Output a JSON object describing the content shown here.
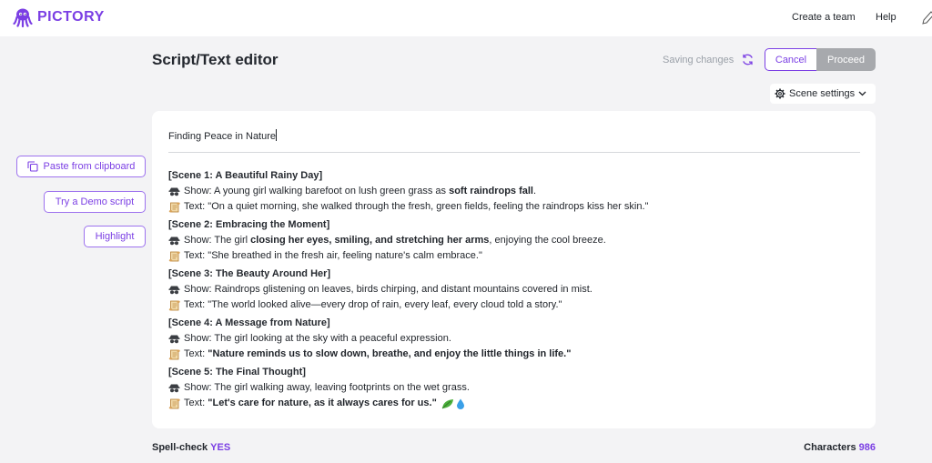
{
  "app": {
    "brand": "PICTORY",
    "brand_color": "#7b3fe4"
  },
  "topnav": {
    "create_team": "Create a team",
    "help": "Help"
  },
  "header": {
    "title": "Script/Text editor",
    "saving_status": "Saving changes",
    "cancel_label": "Cancel",
    "proceed_label": "Proceed",
    "scene_settings_label": "Scene settings"
  },
  "sidebar": {
    "paste_label": "Paste from clipboard",
    "demo_label": "Try a Demo script",
    "highlight_label": "Highlight"
  },
  "editor": {
    "title": "Finding Peace in Nature",
    "scenes": [
      {
        "heading": "[Scene 1: A Beautiful Rainy Day]",
        "show_prefix": "Show:",
        "show_before": " A young girl walking barefoot on lush green grass as ",
        "show_bold": "soft raindrops fall",
        "show_after": ".",
        "text_prefix": "Text:",
        "text_plain": " \"On a quiet morning, she walked through the fresh, green fields, feeling the raindrops kiss her skin.\"",
        "text_bold": ""
      },
      {
        "heading": "[Scene 2: Embracing the Moment]",
        "show_prefix": "Show:",
        "show_before": " The girl ",
        "show_bold": "closing her eyes, smiling, and stretching her arms",
        "show_after": ", enjoying the cool breeze.",
        "text_prefix": "Text:",
        "text_plain": " \"She breathed in the fresh air, feeling nature's calm embrace.\"",
        "text_bold": ""
      },
      {
        "heading": "[Scene 3: The Beauty Around Her]",
        "show_prefix": "Show:",
        "show_before": " Raindrops glistening on leaves, birds chirping, and distant mountains covered in mist.",
        "show_bold": "",
        "show_after": "",
        "text_prefix": "Text:",
        "text_plain": " \"The world looked alive—every drop of rain, every leaf, every cloud told a story.\"",
        "text_bold": ""
      },
      {
        "heading": "[Scene 4: A Message from Nature]",
        "show_prefix": "Show:",
        "show_before": " The girl looking at the sky with a peaceful expression.",
        "show_bold": "",
        "show_after": "",
        "text_prefix": "Text:",
        "text_plain": " ",
        "text_bold": "\"Nature reminds us to slow down, breathe, and enjoy the little things in life.\""
      },
      {
        "heading": "[Scene 5: The Final Thought]",
        "show_prefix": "Show:",
        "show_before": " The girl walking away, leaving footprints on the wet grass.",
        "show_bold": "",
        "show_after": "",
        "text_prefix": "Text:",
        "text_plain": " ",
        "text_bold": "\"Let's care for nature, as it always cares for us.\""
      }
    ],
    "closing_emojis": [
      "leaf-icon",
      "droplet-icon"
    ]
  },
  "footer": {
    "spellcheck_label": "Spell-check",
    "spellcheck_value": "YES",
    "characters_label": "Characters",
    "characters_value": "986"
  },
  "colors": {
    "accent": "#7b3fe4",
    "proceed_disabled": "#a7a9ad",
    "background": "#f3f3f5"
  }
}
